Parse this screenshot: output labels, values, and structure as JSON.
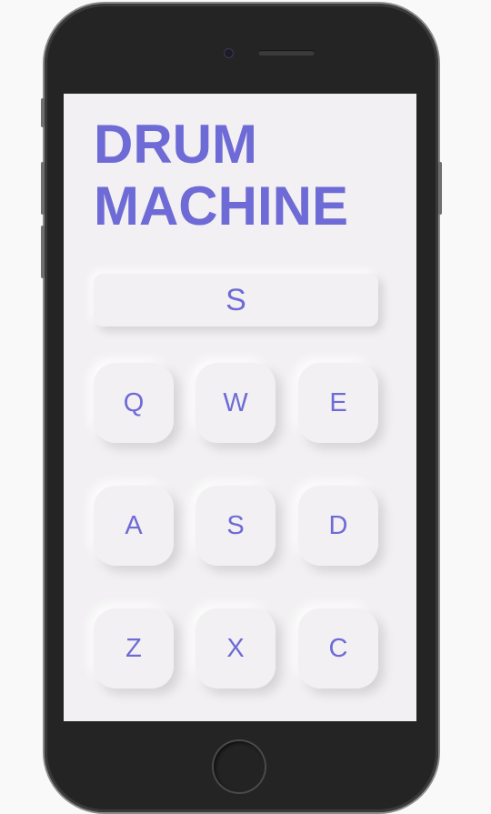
{
  "app": {
    "title_line1": "DRUM",
    "title_line2": "MACHINE"
  },
  "display": {
    "value": "S"
  },
  "pads": [
    {
      "key": "Q"
    },
    {
      "key": "W"
    },
    {
      "key": "E"
    },
    {
      "key": "A"
    },
    {
      "key": "S"
    },
    {
      "key": "D"
    },
    {
      "key": "Z"
    },
    {
      "key": "X"
    },
    {
      "key": "C"
    }
  ],
  "colors": {
    "accent": "#6e6bd6",
    "screen_background": "#f2f0f2",
    "phone_body": "#242424"
  }
}
